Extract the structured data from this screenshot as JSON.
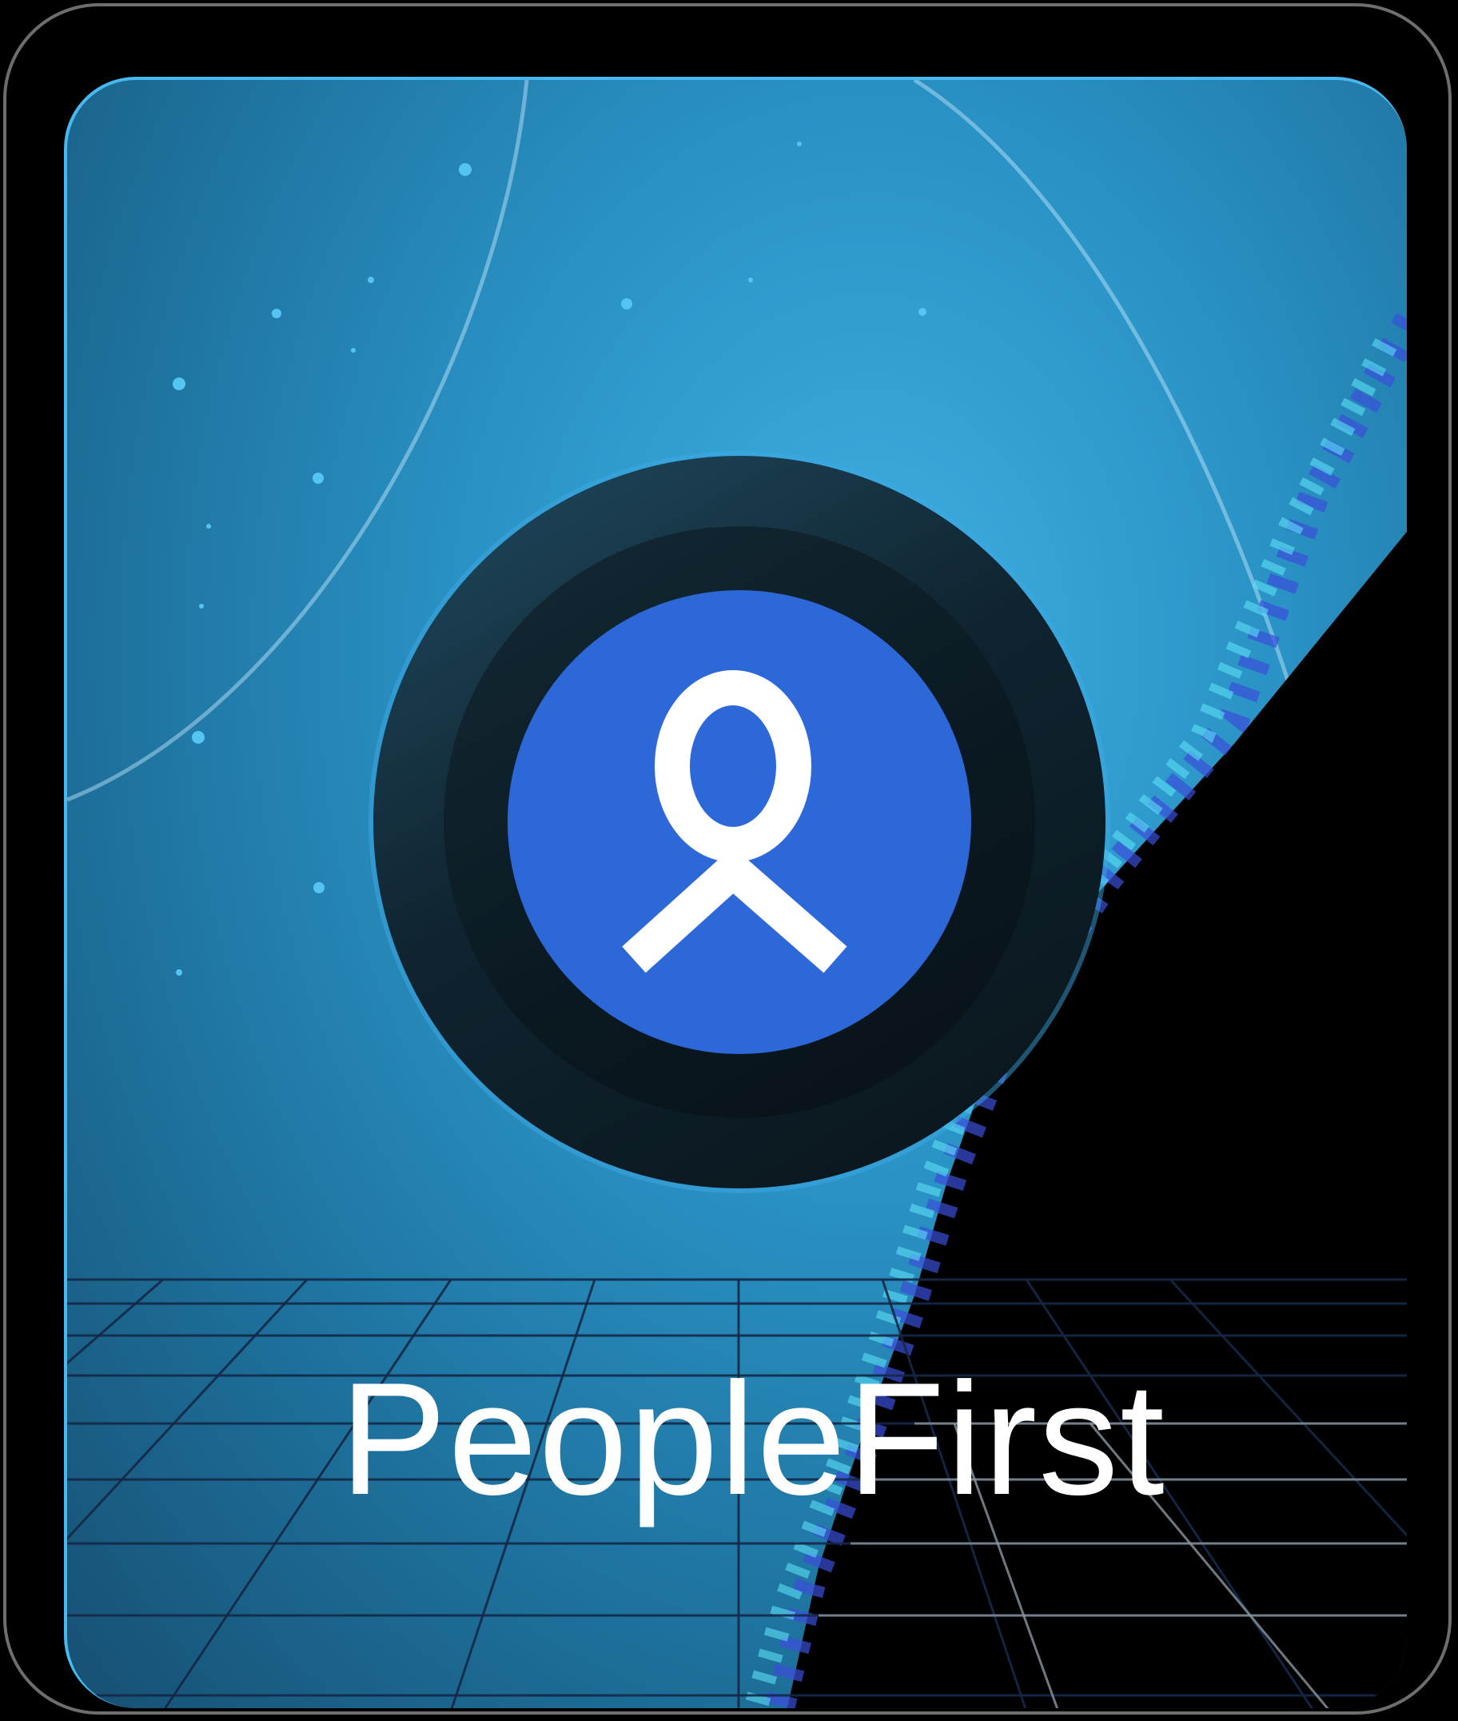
{
  "brand": {
    "name": "PeopleFirst"
  },
  "logo": {
    "icon": "person-icon",
    "core_color": "#2d68d9",
    "ring_color": "#0f2430"
  },
  "colors": {
    "background": "#000000",
    "card_blue": "#2a93c6",
    "accent": "#48b8f0",
    "text": "#ffffff"
  }
}
